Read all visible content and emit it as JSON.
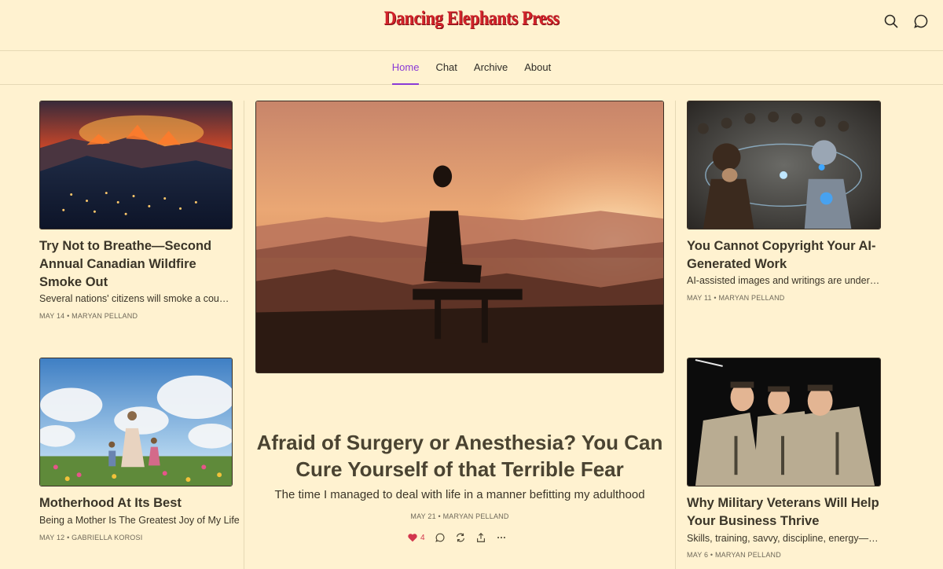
{
  "header": {
    "site_name": "Dancing Elephants Press",
    "accent_color": "#d2232a",
    "icons": [
      "search-icon",
      "chat-bubble-icon"
    ]
  },
  "nav": {
    "items": [
      {
        "label": "Home",
        "active": true
      },
      {
        "label": "Chat",
        "active": false
      },
      {
        "label": "Archive",
        "active": false
      },
      {
        "label": "About",
        "active": false
      }
    ],
    "active_color": "#8a3ad6"
  },
  "posts": {
    "left_top": {
      "title": "Try Not to Breathe—Second Annual Canadian Wildfire Smoke Out",
      "subtitle": "Several nations' citizens will smoke a couple of packs a day without meaning to",
      "date": "MAY 14",
      "author": "MARYAN PELLAND",
      "image": "wildfire over town at night"
    },
    "left_bottom": {
      "title": "Motherhood At Its Best",
      "subtitle": "Being a Mother Is The Greatest Joy of My Life",
      "date": "MAY 12",
      "author": "GABRIELLA KOROSI",
      "image": "mother and children in flower meadow"
    },
    "featured": {
      "title": "Afraid of Surgery or Anesthesia? You Can Cure Yourself of that Terrible Fear",
      "subtitle": "The time I managed to deal with life in a manner befitting my adulthood",
      "date": "MAY 21",
      "author": "MARYAN PELLAND",
      "likes": "4",
      "image": "woman on bench at sunset"
    },
    "right_top": {
      "title": "You Cannot Copyright Your AI-Generated Work",
      "subtitle": "AI-assisted images and writings are under the same rules",
      "date": "MAY 11",
      "author": "MARYAN PELLAND",
      "image": "chimpanzee facing robot"
    },
    "right_bottom": {
      "title": "Why Military Veterans Will Help Your Business Thrive",
      "subtitle": "Skills, training, savvy, discipline, energy—veterans bring it all",
      "date": "MAY 6",
      "author": "MARYAN PELLAND",
      "image": "smiling soldiers group"
    }
  },
  "meta_separator": " • ",
  "action_icons": [
    "heart-icon",
    "comment-icon",
    "restack-icon",
    "share-icon",
    "more-icon"
  ]
}
